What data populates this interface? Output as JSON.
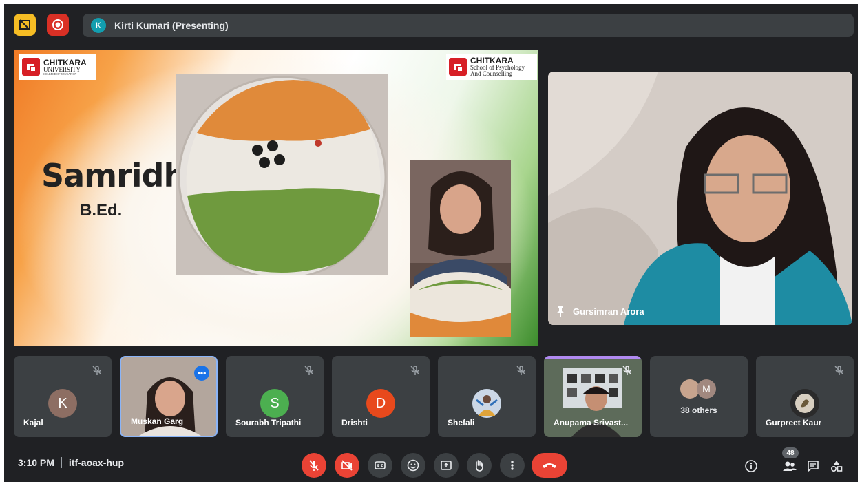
{
  "topbar": {
    "presenter_initial": "K",
    "presenter_label": "Kirti Kumari (Presenting)",
    "icons": [
      "tile-view-off-icon",
      "record-icon"
    ]
  },
  "slide": {
    "logo_left": {
      "title": "CHITKARA",
      "sub": "UNIVERSITY",
      "tiny": "COLLEGE OF EDUCATION"
    },
    "logo_right": {
      "title": "CHITKARA",
      "sub1": "School of Psychology",
      "sub2": "And Counselling"
    },
    "name": "Samridhi",
    "course": "B.Ed."
  },
  "pinned_participant": {
    "name": "Gursimran Arora"
  },
  "participants": [
    {
      "name": "Kajal",
      "initial": "K",
      "avatar_color": "#8d6e63",
      "muted": true
    },
    {
      "name": "Muskan Garg",
      "video": true,
      "active_speaker": true
    },
    {
      "name": "Sourabh Tripathi",
      "initial": "S",
      "avatar_color": "#4caf50",
      "muted": true
    },
    {
      "name": "Drishti",
      "initial": "D",
      "avatar_color": "#e8491c",
      "muted": true
    },
    {
      "name": "Shefali",
      "photo": true,
      "muted": true
    },
    {
      "name": "Anupama Srivast...",
      "video": true,
      "muted": true
    },
    {
      "others_label": "38 others",
      "initial": "M"
    },
    {
      "name": "Gurpreet Kaur",
      "photo": true,
      "muted": true
    }
  ],
  "bottombar": {
    "time": "3:10 PM",
    "meeting_code": "itf-aoax-hup",
    "people_count": "48",
    "colors": {
      "danger": "#ea4335",
      "control": "#3c4043",
      "accent": "#8ab4f8"
    }
  }
}
